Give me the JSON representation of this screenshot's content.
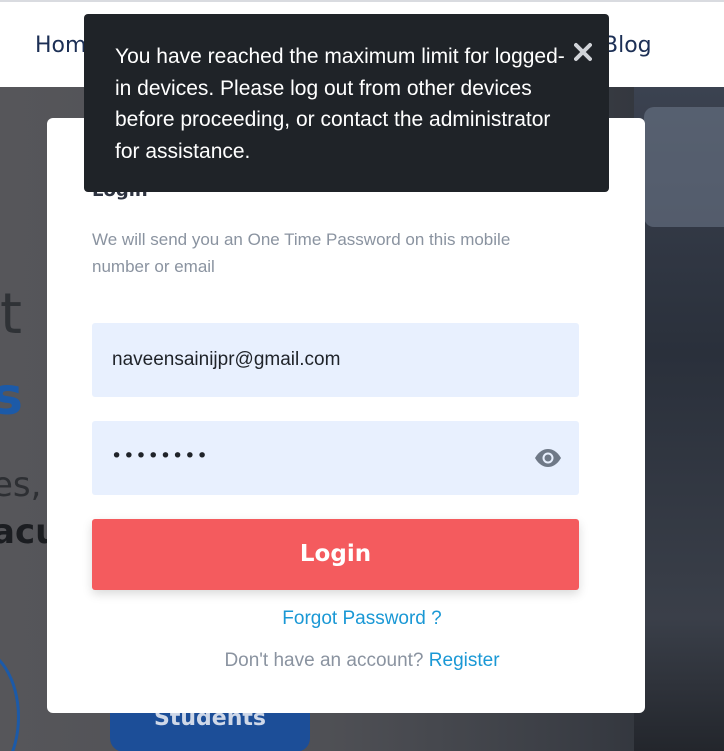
{
  "nav": {
    "home_label": "Home",
    "blog_label": "Blog"
  },
  "hero": {
    "line1": "t",
    "line2": "s",
    "line3": "es,",
    "line4": "acu",
    "badge_text": "Students"
  },
  "login_card": {
    "heading": "Login",
    "subtitle": "We will send you an One Time Password on this mobile number or email",
    "email_value": "naveensainijpr@gmail.com",
    "password_mask": "••••••••",
    "password_toggle_icon": "eye-icon",
    "login_label": "Login",
    "forgot_label": "Forgot Password ?",
    "no_account_text": "Don't have an account?",
    "register_label": "Register"
  },
  "toast": {
    "message": "You have reached the maximum limit for logged-in devices. Please log out from other devices before proceeding, or contact the administrator for assistance.",
    "close_icon": "close-icon"
  },
  "colors": {
    "toast_bg": "#1f2328",
    "login_button": "#f45b5e",
    "link": "#1a98d5",
    "input_bg": "#e8f0fe",
    "nav_text": "#1c2f55"
  }
}
